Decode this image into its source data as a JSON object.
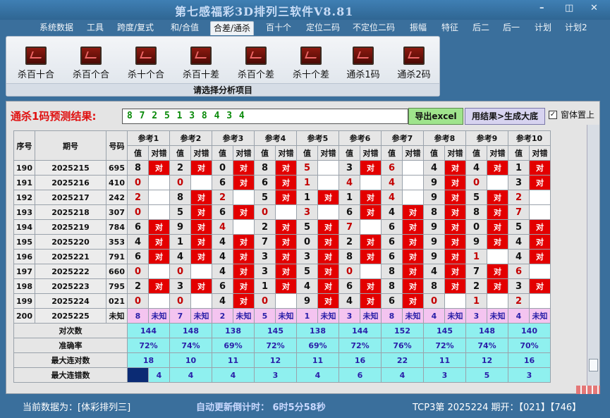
{
  "window": {
    "title": "第七感福彩3D排列三软件V8.81",
    "minimize": "–",
    "restore": "◫",
    "close": "✕"
  },
  "menu": [
    "系统数据",
    "工具",
    "跨度/复式",
    "和/合值",
    "合差/通杀",
    "百十个",
    "定位二码",
    "不定位二码",
    "振幅",
    "特征",
    "后二",
    "后一",
    "计划",
    "计划2"
  ],
  "menu_active": 4,
  "ribbon": {
    "buttons": [
      "杀百十合",
      "杀百个合",
      "杀十个合",
      "杀百十差",
      "杀百个差",
      "杀十个差",
      "通杀1码",
      "通杀2码"
    ],
    "caption": "请选择分析项目"
  },
  "prediction": {
    "label": "通杀1码预测结果:",
    "value": "8 7 2 5 1 3 8 4 3 4"
  },
  "buttons": {
    "excel": "导出excel",
    "generate": "用结果>生成大底"
  },
  "checkbox": {
    "label": "窗体置上",
    "checked": true
  },
  "table": {
    "headers": {
      "no": "序号",
      "period": "期号",
      "num": "号码"
    },
    "refs": [
      "参考1",
      "参考2",
      "参考3",
      "参考4",
      "参考5",
      "参考6",
      "参考7",
      "参考8",
      "参考9",
      "参考10"
    ],
    "sub": {
      "value": "值",
      "result": "对错"
    },
    "hit_text": "对",
    "rows": [
      {
        "no": "190",
        "period": "2025215",
        "num": "695",
        "vals": [
          "8",
          "2",
          "0",
          "8",
          "5",
          "3",
          "6",
          "4",
          "4",
          "1"
        ],
        "hits": [
          1,
          1,
          1,
          1,
          0,
          1,
          0,
          1,
          1,
          1
        ]
      },
      {
        "no": "191",
        "period": "2025216",
        "num": "410",
        "vals": [
          "0",
          "0",
          "6",
          "6",
          "1",
          "4",
          "4",
          "9",
          "0",
          "3"
        ],
        "hits": [
          0,
          0,
          1,
          1,
          0,
          0,
          0,
          1,
          0,
          1
        ]
      },
      {
        "no": "192",
        "period": "2025217",
        "num": "242",
        "vals": [
          "2",
          "8",
          "2",
          "5",
          "1",
          "1",
          "4",
          "9",
          "5",
          "2"
        ],
        "hits": [
          0,
          1,
          0,
          1,
          1,
          1,
          0,
          1,
          1,
          0
        ]
      },
      {
        "no": "193",
        "period": "2025218",
        "num": "307",
        "vals": [
          "0",
          "5",
          "6",
          "0",
          "3",
          "6",
          "4",
          "8",
          "8",
          "7"
        ],
        "hits": [
          0,
          1,
          1,
          0,
          0,
          1,
          1,
          1,
          1,
          0
        ]
      },
      {
        "no": "194",
        "period": "2025219",
        "num": "784",
        "vals": [
          "6",
          "9",
          "4",
          "2",
          "5",
          "7",
          "6",
          "9",
          "0",
          "5"
        ],
        "hits": [
          1,
          1,
          0,
          1,
          1,
          0,
          1,
          1,
          1,
          1
        ]
      },
      {
        "no": "195",
        "period": "2025220",
        "num": "353",
        "vals": [
          "4",
          "1",
          "4",
          "7",
          "0",
          "2",
          "6",
          "9",
          "9",
          "4"
        ],
        "hits": [
          1,
          1,
          1,
          1,
          1,
          1,
          1,
          1,
          1,
          1
        ]
      },
      {
        "no": "196",
        "period": "2025221",
        "num": "791",
        "vals": [
          "6",
          "4",
          "4",
          "3",
          "3",
          "8",
          "6",
          "9",
          "1",
          "4"
        ],
        "hits": [
          1,
          1,
          1,
          1,
          1,
          1,
          1,
          1,
          0,
          1
        ]
      },
      {
        "no": "197",
        "period": "2025222",
        "num": "660",
        "vals": [
          "0",
          "0",
          "4",
          "3",
          "5",
          "0",
          "8",
          "4",
          "7",
          "6"
        ],
        "hits": [
          0,
          0,
          1,
          1,
          1,
          0,
          1,
          1,
          1,
          0
        ]
      },
      {
        "no": "198",
        "period": "2025223",
        "num": "795",
        "vals": [
          "2",
          "3",
          "6",
          "1",
          "4",
          "6",
          "8",
          "8",
          "2",
          "3"
        ],
        "hits": [
          1,
          1,
          1,
          1,
          1,
          1,
          1,
          1,
          1,
          1
        ]
      },
      {
        "no": "199",
        "period": "2025224",
        "num": "021",
        "vals": [
          "0",
          "0",
          "4",
          "0",
          "9",
          "4",
          "6",
          "0",
          "1",
          "2"
        ],
        "hits": [
          0,
          0,
          1,
          0,
          1,
          1,
          1,
          0,
          0,
          0
        ]
      },
      {
        "no": "200",
        "period": "2025225",
        "num": "未知",
        "vals": [
          "8",
          "7",
          "2",
          "5",
          "1",
          "3",
          "8",
          "4",
          "3",
          "4"
        ],
        "unknown": "未知"
      }
    ],
    "stats": [
      {
        "label": "对次数",
        "values": [
          "144",
          "148",
          "138",
          "145",
          "138",
          "144",
          "152",
          "145",
          "148",
          "140"
        ]
      },
      {
        "label": "准确率",
        "values": [
          "72%",
          "74%",
          "69%",
          "72%",
          "69%",
          "72%",
          "76%",
          "72%",
          "74%",
          "70%"
        ]
      },
      {
        "label": "最大连对数",
        "values": [
          "18",
          "10",
          "11",
          "12",
          "11",
          "16",
          "22",
          "11",
          "12",
          "16"
        ]
      },
      {
        "label": "最大连错数",
        "values": [
          "4",
          "4",
          "4",
          "3",
          "4",
          "6",
          "4",
          "3",
          "5",
          "3"
        ]
      }
    ]
  },
  "status": {
    "source": "当前数据为：[体彩排列三]",
    "countdown": "自动更新倒计时：  6时5分58秒",
    "issue": "TCP3第 2025224 期开：【021】【746】"
  },
  "colors": {
    "hit": "#e30000",
    "pink": "#f4c4f0",
    "cyan": "#8ff0ef",
    "background": "#3a6f9c"
  }
}
